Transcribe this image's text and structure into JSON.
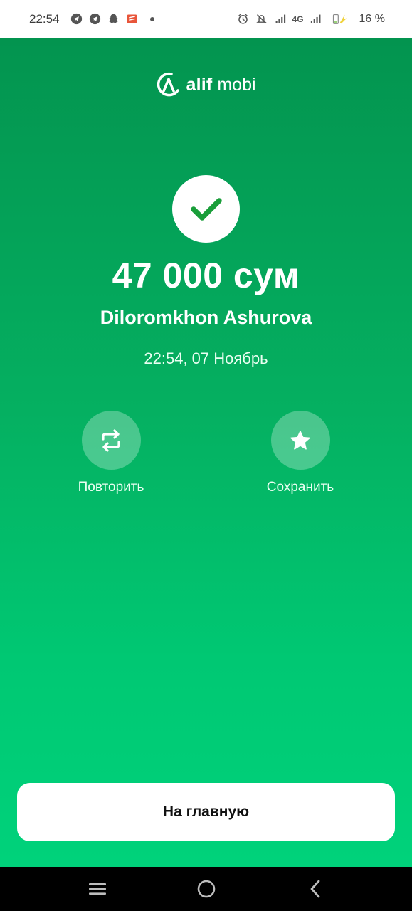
{
  "status_bar": {
    "time": "22:54",
    "network": "4G",
    "battery_percent": "16 %",
    "notification_icons": [
      "telegram-icon",
      "telegram-icon",
      "snapchat-icon",
      "app-notification-icon",
      "more-dot-icon"
    ],
    "system_icons": [
      "alarm-icon",
      "mute-icon",
      "signal-icon",
      "4g-signal-icon",
      "battery-icon"
    ]
  },
  "logo": {
    "brand": "alif",
    "product": "mobi"
  },
  "payment": {
    "amount": "47 000 сум",
    "recipient": "Diloromkhon Ashurova",
    "datetime": "22:54, 07 Ноябрь",
    "status_icon": "checkmark-icon"
  },
  "actions": {
    "repeat_label": "Повторить",
    "save_label": "Сохранить"
  },
  "home_button": {
    "label": "На главную"
  },
  "colors": {
    "gradient_top": "#03944f",
    "gradient_bottom": "#00d27b",
    "check_green": "#1a9e3a"
  },
  "nav_bar": {
    "icons": [
      "menu-icon",
      "home-circle-icon",
      "back-icon"
    ]
  }
}
